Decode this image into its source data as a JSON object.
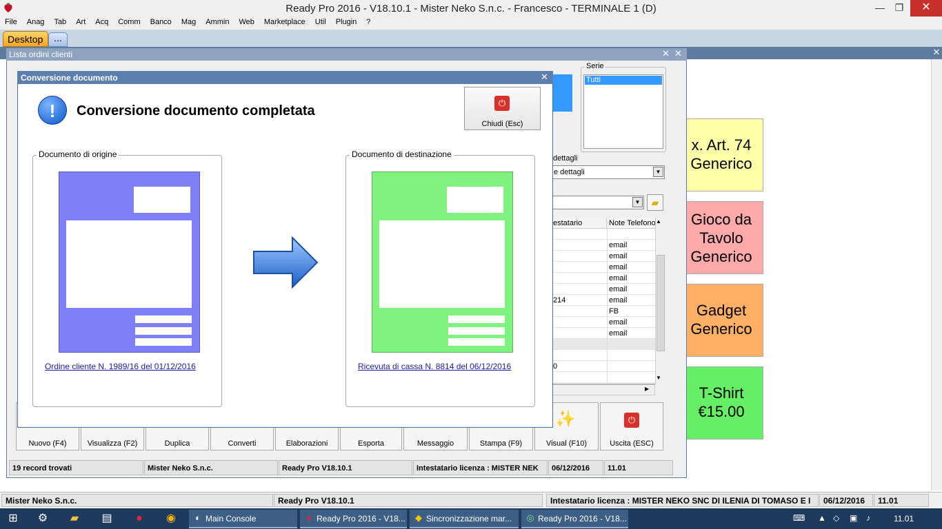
{
  "window": {
    "title": "Ready Pro 2016 - V18.10.1 - Mister Neko S.n.c. - Francesco - TERMINALE 1 (D)",
    "minimize": "—",
    "maximize": "❐",
    "close": "✕"
  },
  "menu": [
    "File",
    "Anag",
    "Tab",
    "Art",
    "Acq",
    "Comm",
    "Banco",
    "Mag",
    "Ammin",
    "Web",
    "Marketplace",
    "Util",
    "Plugin",
    "?"
  ],
  "tabs": {
    "desktop": "Desktop",
    "more": "..."
  },
  "tiles": [
    {
      "l1": "x. Art. 74",
      "l2": "Generico"
    },
    {
      "l1": "Gioco da",
      "l2": "Tavolo",
      "l3": "Generico"
    },
    {
      "l1": "Gadget",
      "l2": "Generico"
    },
    {
      "l1": "T-Shirt",
      "l2": "€15.00"
    }
  ],
  "order_window": {
    "title": "Lista ordini clienti",
    "serie_label": "Serie",
    "serie_selected": "Tutti",
    "dettagli_label": "dettagli",
    "dettagli_value": "e dettagli",
    "grid_headers": [
      "estatario",
      "Note Telefono"
    ],
    "grid_rows": [
      [
        "",
        ""
      ],
      [
        "",
        "email"
      ],
      [
        "",
        "email"
      ],
      [
        "",
        "email"
      ],
      [
        "",
        "email"
      ],
      [
        "",
        "email"
      ],
      [
        "214",
        "email"
      ],
      [
        "",
        "FB"
      ],
      [
        "",
        "email"
      ],
      [
        "",
        "email"
      ],
      [
        "",
        ""
      ],
      [
        "",
        ""
      ],
      [
        "0",
        ""
      ],
      [
        "",
        ""
      ]
    ],
    "buttons": [
      "Nuovo (F4)",
      "Visualizza (F2)",
      "Duplica",
      "Converti",
      "Elaborazioni",
      "Esporta",
      "Messaggio",
      "Stampa (F9)",
      "Visual (F10)",
      "Uscita (ESC)"
    ],
    "status": [
      "19 record trovati",
      "Mister Neko S.n.c.",
      "Ready Pro V18.10.1",
      "Intestatario licenza : MISTER NEK",
      "06/12/2016",
      "11.01"
    ]
  },
  "modal": {
    "title": "Conversione documento",
    "heading": "Conversione documento completata",
    "close_button": "Chiudi (Esc)",
    "origin_label": "Documento di origine",
    "dest_label": "Documento di destinazione",
    "origin_link": "Ordine cliente N. 1989/16 del 01/12/2016",
    "dest_link": "Ricevuta di cassa N. 8814 del 06/12/2016",
    "origin_color": "#7f7ff8",
    "dest_color": "#7ff27f"
  },
  "statusbar": [
    "Mister Neko S.n.c.",
    "Ready Pro V18.10.1",
    "Intestatario licenza : MISTER NEKO SNC DI ILENIA DI TOMASO E I",
    "06/12/2016",
    "11.01"
  ],
  "taskbar": {
    "tasks": [
      "Main Console",
      "Ready Pro 2016 - V18...",
      "Sincronizzazione mar...",
      "Ready Pro 2016 - V18..."
    ],
    "clock": "11.01"
  }
}
